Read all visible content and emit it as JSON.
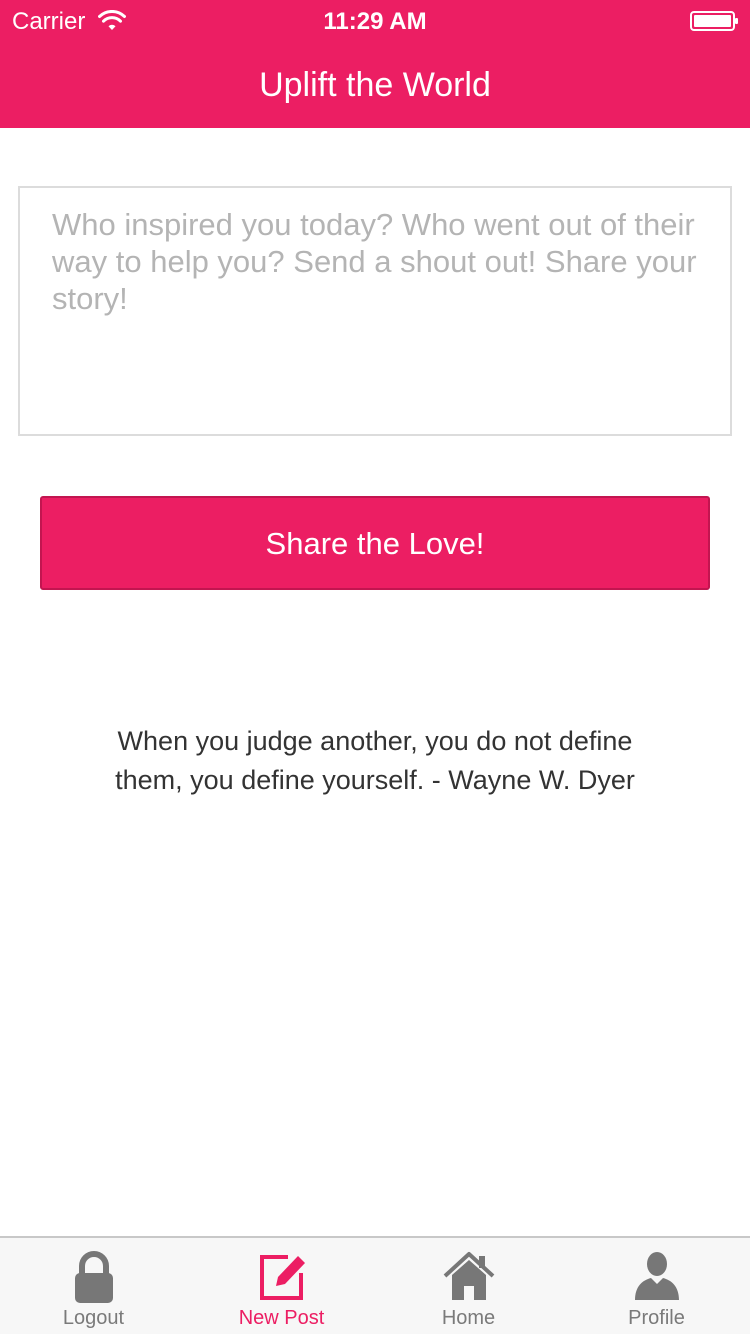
{
  "status_bar": {
    "carrier": "Carrier",
    "time": "11:29 AM"
  },
  "nav": {
    "title": "Uplift the World"
  },
  "post": {
    "placeholder": "Who inspired you today? Who went out of their way to help you? Send a shout out! Share your story!",
    "value": "",
    "submit_label": "Share the Love!"
  },
  "quote": {
    "text": "When you judge another, you do not define them, you define yourself. - Wayne W. Dyer"
  },
  "tabbar": {
    "tabs": [
      {
        "label": "Logout",
        "icon": "lock-icon"
      },
      {
        "label": "New Post",
        "icon": "compose-icon",
        "active": true
      },
      {
        "label": "Home",
        "icon": "home-icon"
      },
      {
        "label": "Profile",
        "icon": "person-icon"
      }
    ]
  },
  "colors": {
    "accent": "#EC1E63",
    "tab_inactive": "#7a7a7a",
    "placeholder": "#b4b4b4"
  }
}
